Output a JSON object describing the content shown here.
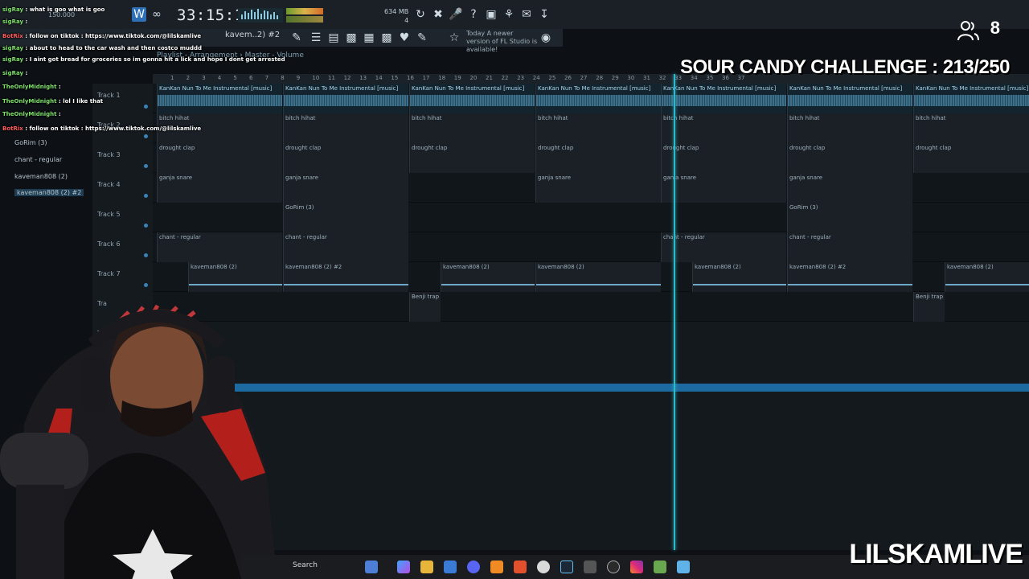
{
  "toolbar": {
    "time": "33:15:15",
    "tempo": "150.000",
    "memory": "634 MB",
    "cpu_num": "4",
    "pattern": "kavem..2) #2",
    "update_notice": "Today  A newer version of FL Studio is available!"
  },
  "breadcrumb": "Playlist - Arrangement › Master - Volume",
  "ruler_bars": [
    "1",
    "2",
    "3",
    "4",
    "5",
    "6",
    "7",
    "8",
    "9",
    "10",
    "11",
    "12",
    "13",
    "14",
    "15",
    "16",
    "17",
    "18",
    "19",
    "20",
    "21",
    "22",
    "23",
    "24",
    "25",
    "26",
    "27",
    "28",
    "29",
    "30",
    "31",
    "32",
    "33",
    "34",
    "35",
    "36",
    "37"
  ],
  "track_labels": [
    "Track 1",
    "Track 2",
    "Track 3",
    "Track 4",
    "Track 5",
    "Track 6",
    "Track 7",
    "Tra",
    "Tra"
  ],
  "clip_names": {
    "t1": "KanKan Nun To Me Instrumental [music]",
    "t2": "bitch hihat",
    "t3": "drought clap",
    "t4": "ganja snare",
    "t5": "GoRim (3)",
    "t6": "chant - regular",
    "t7a": "kaveman808 (2)",
    "t7b": "kaveman808 (2) #2",
    "t8": "Benji trap"
  },
  "picker": [
    "GoRim (3)",
    "chant - regular",
    "kaveman808 (2)",
    "kaveman808 (2) #2"
  ],
  "chat": [
    {
      "user": "sigRay",
      "text": "what is goo what is goo",
      "bot": false
    },
    {
      "user": "sigRay",
      "text": "",
      "bot": false
    },
    {
      "user": "BotRix",
      "text": "follow on tiktok : https://www.tiktok.com/@lilskamlive",
      "bot": true
    },
    {
      "user": "sigRay",
      "text": "about to head to the car wash and then costco muddd",
      "bot": false
    },
    {
      "user": "sigRay",
      "text": "I aint got bread for groceries so im gonna hit a lick and hope I dont get arrested",
      "bot": false
    },
    {
      "user": "sigRay",
      "text": "",
      "bot": false
    },
    {
      "user": "TheOnlyMidnight",
      "text": "",
      "bot": false
    },
    {
      "user": "TheOnlyMidnight",
      "text": "lol I like that",
      "bot": false
    },
    {
      "user": "TheOnlyMidnight",
      "text": "",
      "bot": false
    },
    {
      "user": "BotRix",
      "text": "follow on tiktok : https://www.tiktok.com/@lilskamlive",
      "bot": true
    }
  ],
  "viewers": "8",
  "challenge": "SOUR CANDY CHALLENGE : 213/250",
  "brand": "LILSKAMLIVE",
  "taskbar": {
    "search": "Search"
  },
  "colors": {
    "playhead": "#2fb8c9",
    "accent": "#1c6aa0",
    "chat_user": "#7ee06a",
    "bot_user": "#ff5b5b"
  }
}
